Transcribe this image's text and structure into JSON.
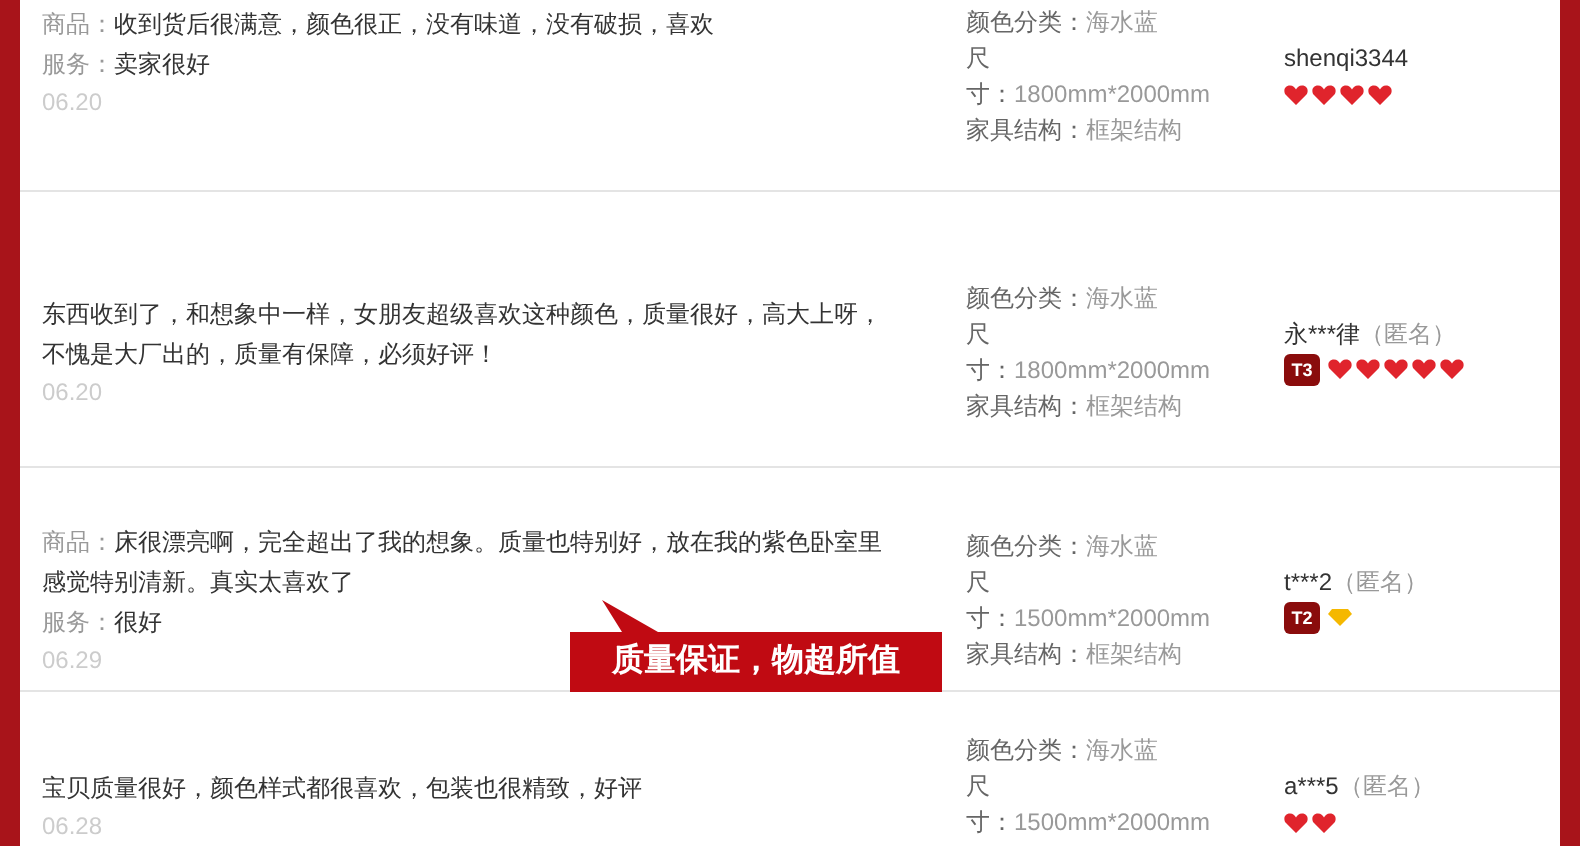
{
  "reviews": [
    {
      "comment": [
        {
          "label": "商品：",
          "text": "收到货后很满意，颜色很正，没有味道，没有破损，喜欢"
        },
        {
          "label": "服务：",
          "text": "卖家很好"
        }
      ],
      "date": "06.20",
      "specs": [
        {
          "label": "颜色分类：",
          "value": "海水蓝"
        },
        {
          "label": "尺寸：",
          "value": "1800mm*2000mm"
        },
        {
          "label": "家具结构：",
          "value": "框架结构"
        }
      ],
      "user": {
        "name": "shenqi3344"
      },
      "credit_icons": [
        {
          "kind": "heart"
        },
        {
          "kind": "heart"
        },
        {
          "kind": "heart"
        },
        {
          "kind": "heart"
        }
      ]
    },
    {
      "comment": [
        {
          "text": "东西收到了，和想象中一样，女朋友超级喜欢这种颜色，质量很好，高大上呀，不愧是大厂出的，质量有保障，必须好评！"
        }
      ],
      "date": "06.20",
      "specs": [
        {
          "label": "颜色分类：",
          "value": "海水蓝"
        },
        {
          "label": "尺寸：",
          "value": "1800mm*2000mm"
        },
        {
          "label": "家具结构：",
          "value": "框架结构"
        }
      ],
      "user": {
        "name": "永***律",
        "note": "（匿名）",
        "badge": "T3"
      },
      "credit_icons": [
        {
          "kind": "heart"
        },
        {
          "kind": "heart"
        },
        {
          "kind": "heart"
        },
        {
          "kind": "heart"
        },
        {
          "kind": "heart"
        }
      ]
    },
    {
      "comment": [
        {
          "label": "商品：",
          "text": "床很漂亮啊，完全超出了我的想象。质量也特别好，放在我的紫色卧室里感觉特别清新。真实太喜欢了"
        },
        {
          "label": "服务：",
          "text": "很好"
        }
      ],
      "date": "06.29",
      "specs": [
        {
          "label": "颜色分类：",
          "value": "海水蓝"
        },
        {
          "label": "尺寸：",
          "value": "1500mm*2000mm"
        },
        {
          "label": "家具结构：",
          "value": "框架结构"
        }
      ],
      "user": {
        "name": "t***2",
        "note": "（匿名）",
        "badge": "T2"
      },
      "credit_icons": [
        {
          "kind": "diamond"
        }
      ],
      "callout": "质量保证，物超所值"
    },
    {
      "comment": [
        {
          "text": "宝贝质量很好，颜色样式都很喜欢，包装也很精致，好评"
        }
      ],
      "date": "06.28",
      "specs": [
        {
          "label": "颜色分类：",
          "value": "海水蓝"
        },
        {
          "label": "尺寸：",
          "value": "1500mm*2000mm"
        }
      ],
      "user": {
        "name": "a***5",
        "note": "（匿名）"
      },
      "credit_icons": [
        {
          "kind": "heart"
        },
        {
          "kind": "heart"
        }
      ]
    }
  ]
}
